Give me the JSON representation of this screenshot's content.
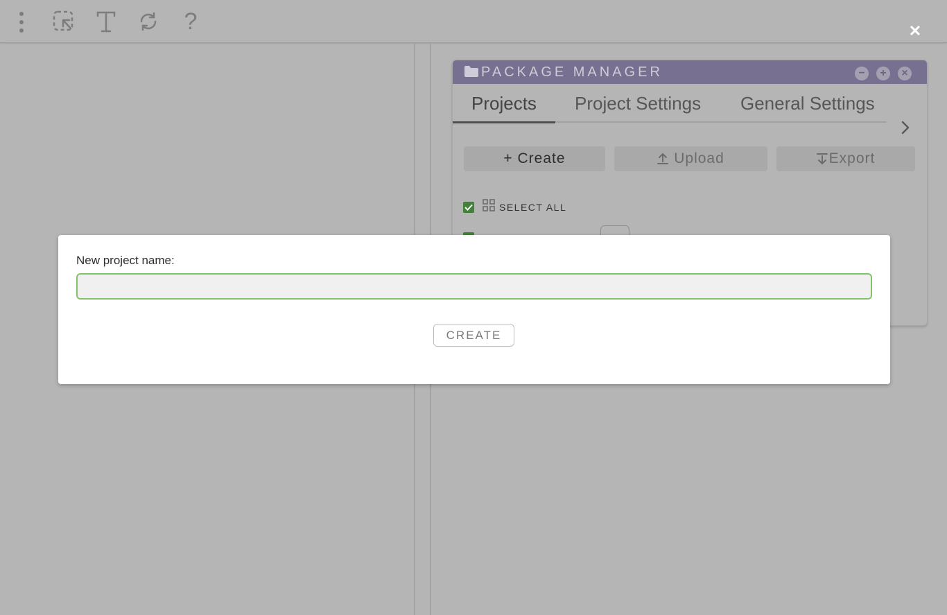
{
  "toolbar": {
    "icons": [
      "more-vertical-icon",
      "select-cursor-icon",
      "text-icon",
      "refresh-icon",
      "help-icon"
    ],
    "help_glyph": "?",
    "close_glyph": "✕"
  },
  "package_manager": {
    "title": "PACKAGE MANAGER",
    "header_color": "#787090",
    "controls": {
      "minimize": "−",
      "maximize": "+",
      "close": "×"
    },
    "tabs": [
      {
        "label": "Projects",
        "active": true
      },
      {
        "label": "Project Settings",
        "active": false
      },
      {
        "label": "General Settings",
        "active": false
      }
    ],
    "buttons": {
      "create": "+ Create",
      "upload": "Upload",
      "export": "Export"
    },
    "select_all": {
      "label": "SELECT ALL",
      "checked": true
    },
    "accent_checkbox_color": "#43803a"
  },
  "modal": {
    "label": "New project name:",
    "input_value": "",
    "input_border_color": "#82c26a",
    "button": "CREATE"
  }
}
